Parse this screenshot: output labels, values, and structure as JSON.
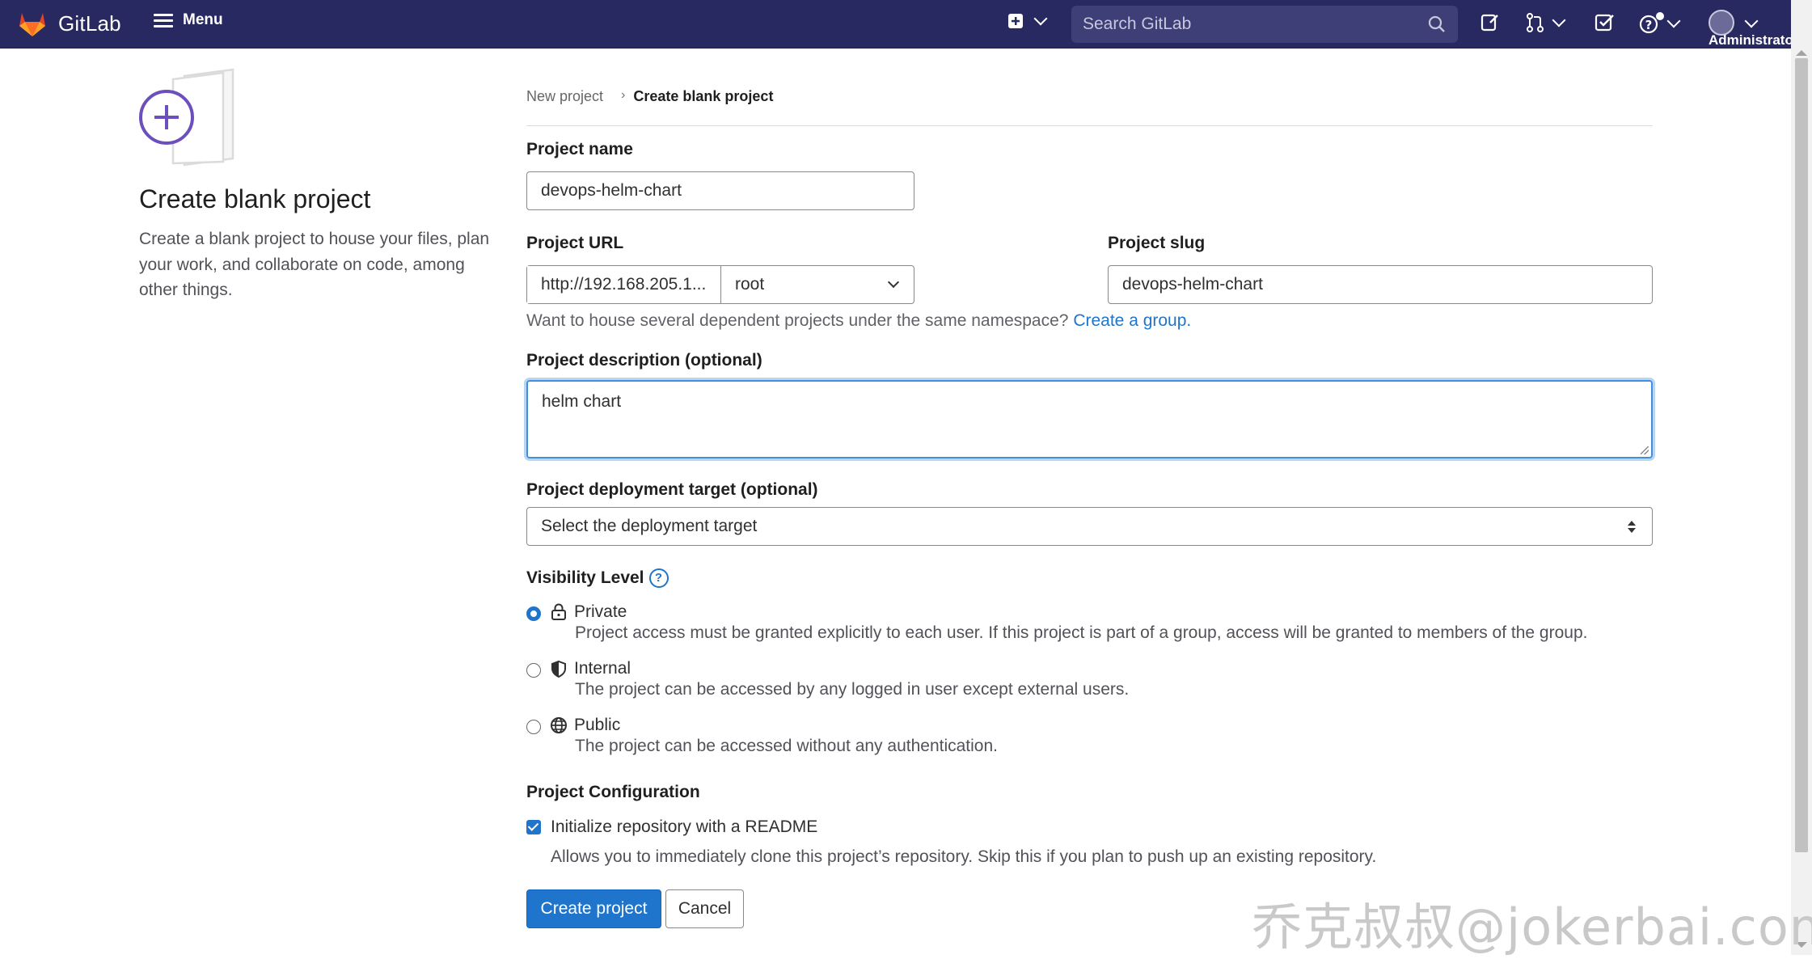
{
  "navbar": {
    "brand": "GitLab",
    "menu_label": "Menu",
    "search_placeholder": "Search GitLab",
    "user_label": "Administrator"
  },
  "sidebar": {
    "title": "Create blank project",
    "description": "Create a blank project to house your files, plan your work, and collaborate on code, among other things."
  },
  "breadcrumb": {
    "parent": "New project",
    "current": "Create blank project"
  },
  "form": {
    "project_name_label": "Project name",
    "project_name_value": "devops-helm-chart",
    "project_url_label": "Project URL",
    "project_url_prefix": "http://192.168.205.1...",
    "project_url_namespace": "root",
    "project_slug_label": "Project slug",
    "project_slug_value": "devops-helm-chart",
    "namespace_hint": "Want to house several dependent projects under the same namespace?",
    "namespace_hint_link": "Create a group.",
    "description_label": "Project description (optional)",
    "description_value": "helm chart",
    "deployment_label": "Project deployment target (optional)",
    "deployment_value": "Select the deployment target",
    "visibility_label": "Visibility Level",
    "visibility_options": [
      {
        "title": "Private",
        "description": "Project access must be granted explicitly to each user. If this project is part of a group, access will be granted to members of the group.",
        "checked": true,
        "icon": "lock-icon"
      },
      {
        "title": "Internal",
        "description": "The project can be accessed by any logged in user except external users.",
        "checked": false,
        "icon": "shield-icon"
      },
      {
        "title": "Public",
        "description": "The project can be accessed without any authentication.",
        "checked": false,
        "icon": "globe-icon"
      }
    ],
    "config_label": "Project Configuration",
    "readme_label": "Initialize repository with a README",
    "readme_checked": true,
    "readme_hint": "Allows you to immediately clone this project’s repository. Skip this if you plan to push up an existing repository.",
    "submit_label": "Create project",
    "cancel_label": "Cancel"
  },
  "watermark": "乔克叔叔@jokerbai.com",
  "colors": {
    "navbar": "#292961",
    "primary": "#1f75cb",
    "link": "#1f75cb"
  }
}
